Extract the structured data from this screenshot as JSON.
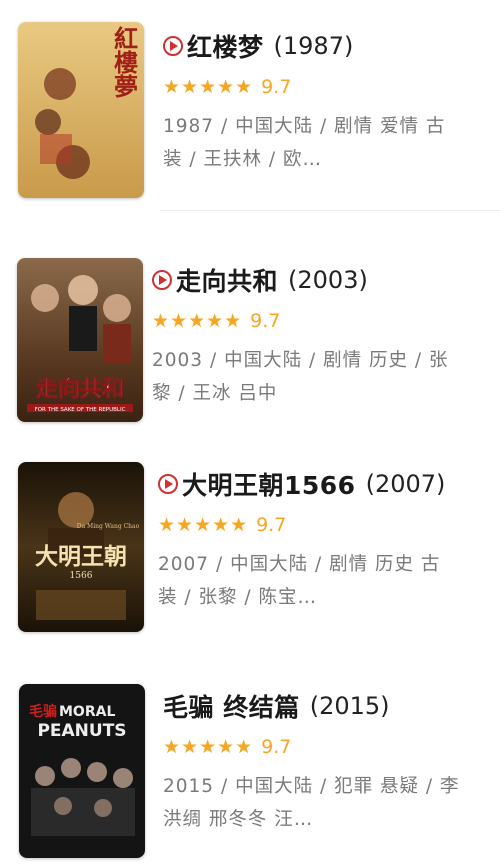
{
  "movies": [
    {
      "title": "红楼梦",
      "year": "(1987)",
      "stars": "★★★★★",
      "score": "9.7",
      "meta": "1987 / 中国大陆 / 剧情 爱情 古装 / 王扶林 / 欧…",
      "has_play": true,
      "poster_text": "紅樓夢"
    },
    {
      "title": "走向共和",
      "year": "(2003)",
      "stars": "★★★★★",
      "score": "9.7",
      "meta": "2003 / 中国大陆 / 剧情 历史 / 张黎 / 王冰 吕中",
      "has_play": true,
      "poster_text": "走向共和",
      "poster_subtext": "FOR THE SAKE OF THE REPUBLIC"
    },
    {
      "title": "大明王朝1566",
      "year": "(2007)",
      "stars": "★★★★★",
      "score": "9.7",
      "meta": "2007 / 中国大陆 / 剧情 历史 古装 / 张黎 / 陈宝…",
      "has_play": true,
      "poster_text": "大明王朝",
      "poster_subtext": "1566",
      "poster_topline": "Da Ming Wang Chao"
    },
    {
      "title": "毛骗 终结篇",
      "year": "(2015)",
      "stars": "★★★★★",
      "score": "9.7",
      "meta": "2015 / 中国大陆 / 犯罪 悬疑 / 李洪绸 邢冬冬 汪…",
      "has_play": false,
      "poster_text": "MORAL PEANUTS",
      "poster_text_line1": "MORAL",
      "poster_text_line2": "PEANUTS",
      "poster_logo": "毛骗"
    }
  ],
  "colors": {
    "accent": "#d03030",
    "star": "#f5a623",
    "meta": "#7a7a7a"
  }
}
